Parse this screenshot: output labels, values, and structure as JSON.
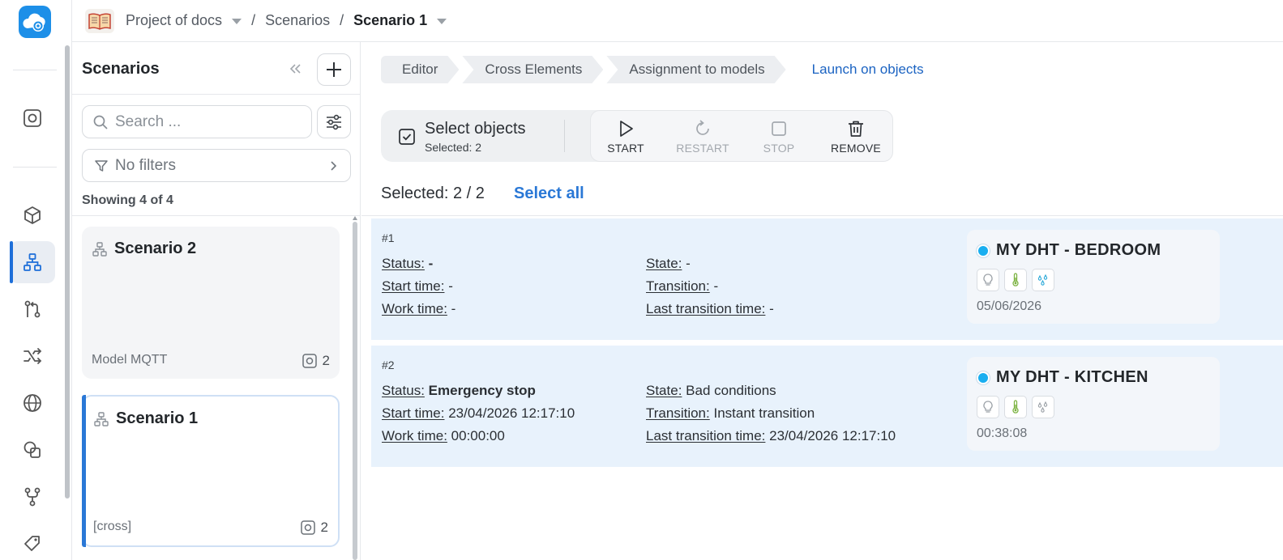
{
  "breadcrumb": {
    "project": "Project of docs",
    "section": "Scenarios",
    "current": "Scenario 1",
    "separator": "/"
  },
  "panel": {
    "title": "Scenarios",
    "search_placeholder": "Search ...",
    "filters_label": "No filters",
    "showing": "Showing 4 of 4",
    "cards": [
      {
        "title": "Scenario 2",
        "footer": "Model MQTT",
        "count": "2",
        "selected": false
      },
      {
        "title": "Scenario 1",
        "footer": "[cross]",
        "count": "2",
        "selected": true
      }
    ]
  },
  "steps": [
    "Editor",
    "Cross Elements",
    "Assignment to models",
    "Launch on objects"
  ],
  "toolbar": {
    "select_title": "Select objects",
    "select_sub": "Selected: 2",
    "start": "START",
    "restart": "RESTART",
    "stop": "STOP",
    "remove": "REMOVE"
  },
  "selection": {
    "text": "Selected: 2 / 2",
    "select_all": "Select all"
  },
  "labels": {
    "status": "Status:",
    "start_time": "Start time:",
    "work_time": "Work time:",
    "state": "State:",
    "transition": "Transition:",
    "last_transition_time": "Last transition time:"
  },
  "rows": [
    {
      "num": "#1",
      "status": "-",
      "start_time": "-",
      "work_time": "-",
      "state": "-",
      "transition": "-",
      "last_transition_time": "-",
      "object_name": "MY DHT - BEDROOM",
      "object_when": "05/06/2026"
    },
    {
      "num": "#2",
      "status": "Emergency stop",
      "start_time": "23/04/2026 12:17:10",
      "work_time": "00:00:00",
      "state": "Bad conditions",
      "transition": "Instant transition",
      "last_transition_time": "23/04/2026 12:17:10",
      "object_name": "MY DHT - KITCHEN",
      "object_when": "00:38:08"
    }
  ],
  "colors": {
    "accent": "#2a78d6",
    "row_bg": "#e8f2fc",
    "online_dot": "#19aef0",
    "thermo": "#7cb342"
  }
}
